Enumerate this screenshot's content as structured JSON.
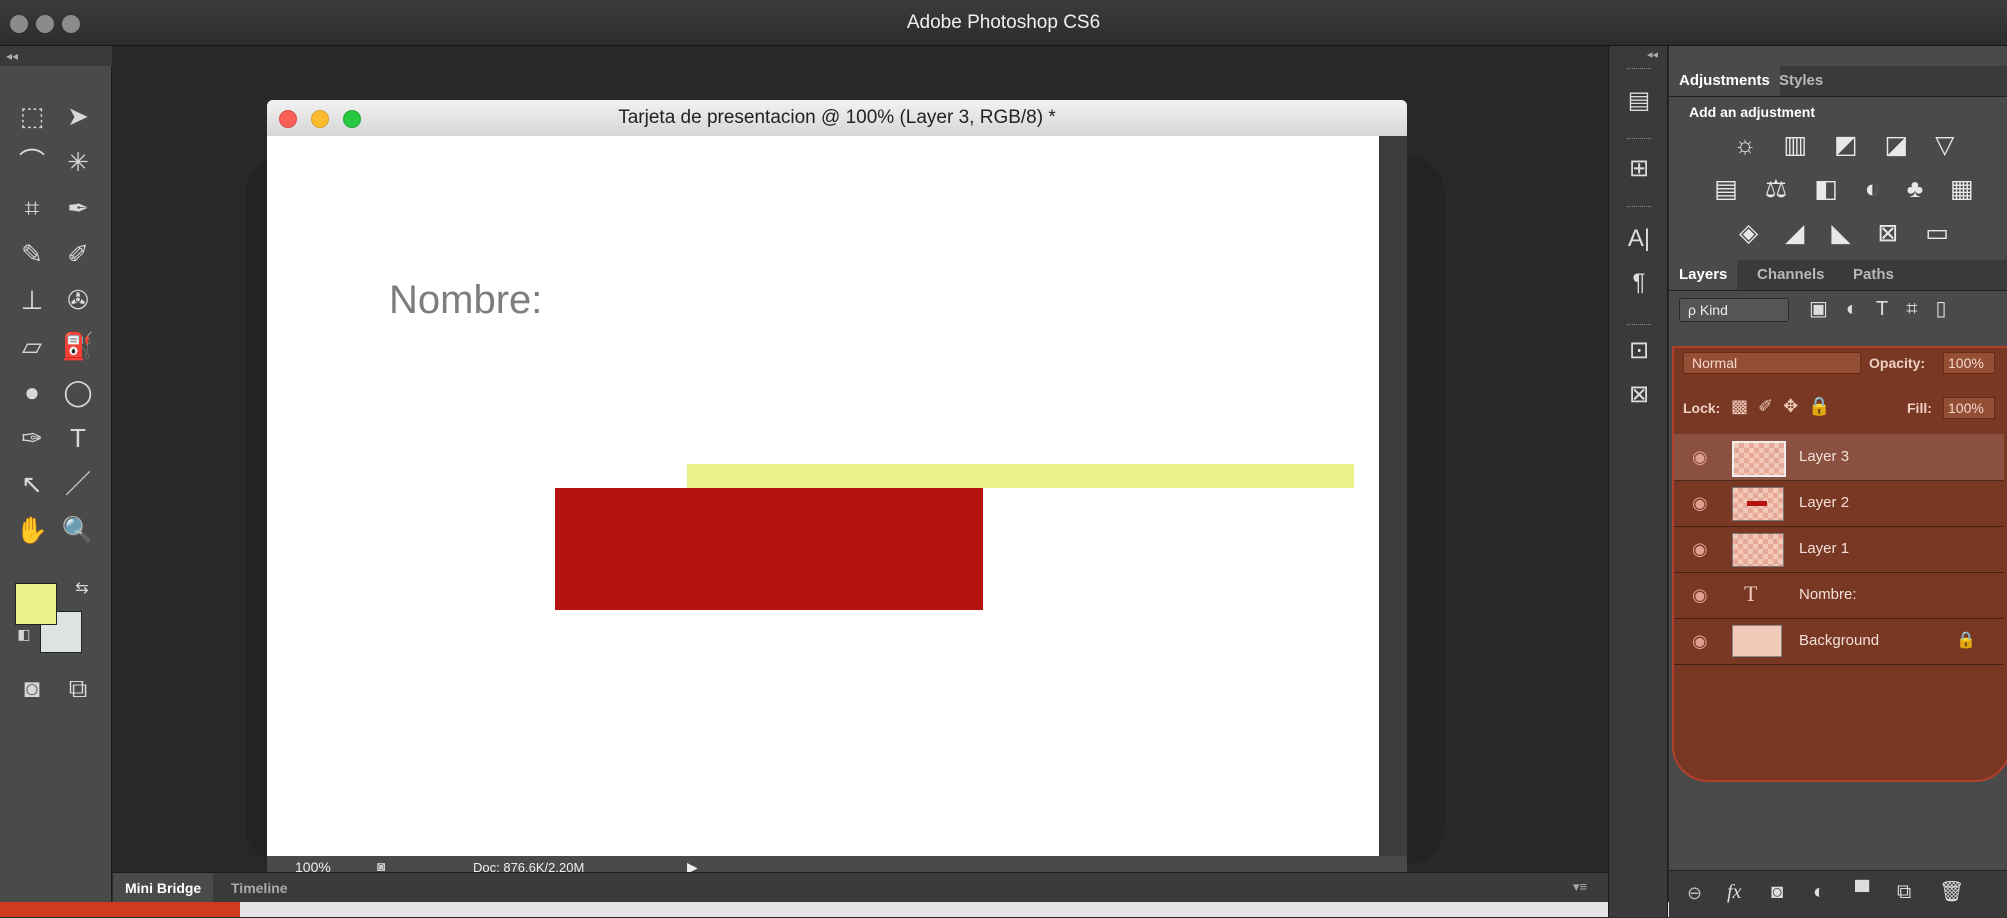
{
  "app": {
    "title": "Adobe Photoshop CS6"
  },
  "tools": {
    "collapse_glyph": "◂◂",
    "icons": [
      "marquee-icon",
      "move-icon",
      "lasso-icon",
      "magic-wand-icon",
      "crop-icon",
      "eyedropper-icon",
      "healing-brush-icon",
      "brush-icon",
      "clone-stamp-icon",
      "history-brush-icon",
      "eraser-icon",
      "paint-bucket-icon",
      "blur-icon",
      "dodge-icon",
      "pen-icon",
      "type-icon",
      "path-selection-icon",
      "line-icon",
      "hand-icon",
      "zoom-icon",
      "quick-mask-icon",
      "screen-mode-icon"
    ],
    "glyphs": [
      "⬚",
      "➤",
      "⌒",
      "✳",
      "⌗",
      "✒",
      "✎",
      "✐",
      "⊥",
      "✇",
      "▱",
      "⛽",
      "●",
      "◯",
      "✑",
      "T",
      "↖",
      "／",
      "✋",
      "🔍",
      "◙",
      "⧉"
    ],
    "foreground_color": "#ecf28a",
    "background_color": "#dde3e3"
  },
  "document": {
    "title": "Tarjeta de presentacion @ 100% (Layer 3, RGB/8) *",
    "zoom": "100%",
    "doc_info": "Doc: 876.6K/2.20M",
    "canvas": {
      "text": "Nombre:",
      "yellow_bar_color": "#ecf28a",
      "red_rect_color": "#b3120f"
    }
  },
  "bottom_tabs": [
    "Mini Bridge",
    "Timeline"
  ],
  "adjustments": {
    "tabs": [
      "Adjustments",
      "Styles"
    ],
    "heading": "Add an adjustment",
    "row1": "☼ ▥ ◩ ◪ ▽",
    "row2": "▤ ⚖ ◧ ◐ ♣ ▦",
    "row3": "◈ ◢ ◣ ⊠ ▭"
  },
  "layers_panel": {
    "tabs": [
      "Layers",
      "Channels",
      "Paths"
    ],
    "filter_label": "ρ Kind",
    "blend_mode": "Normal",
    "opacity_label": "Opacity:",
    "opacity_value": "100%",
    "lock_label": "Lock:",
    "fill_label": "Fill:",
    "fill_value": "100%",
    "layers": [
      {
        "name": "Layer 3",
        "selected": true
      },
      {
        "name": "Layer 2",
        "selected": false
      },
      {
        "name": "Layer 1",
        "selected": false
      },
      {
        "name": "Nombre:",
        "selected": false,
        "type": "text"
      },
      {
        "name": "Background",
        "selected": false,
        "locked": true
      }
    ],
    "bottom_icons": [
      "link-icon",
      "fx-icon",
      "mask-icon",
      "adjustment-layer-icon",
      "group-folder-icon",
      "new-layer-icon",
      "trash-icon"
    ]
  }
}
